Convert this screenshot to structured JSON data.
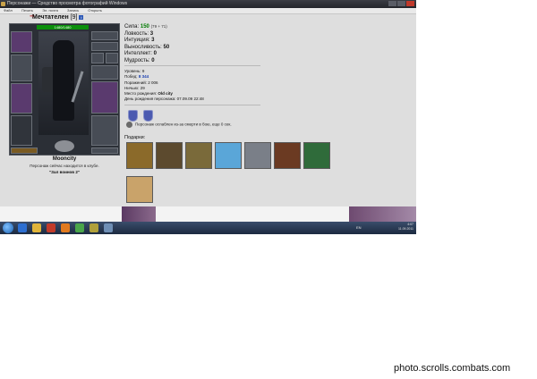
{
  "window": {
    "title": "Персонажи — Средство просмотра фотографий Windows",
    "menu": [
      "Файл",
      "Печать",
      "Эл. почта",
      "Запись",
      "Открыть"
    ]
  },
  "character": {
    "name": "Мечтателен",
    "level": "[9]",
    "info_badge": "i",
    "hp": "1480/1480",
    "owner": "Mooncity",
    "location_text": "Персонаж сейчас находится в клубе.",
    "location_room": "\"Зал воинов 2\""
  },
  "stats": [
    {
      "label": "Сила:",
      "value": "150",
      "extra": "(79 + 71)"
    },
    {
      "label": "Ловкость:",
      "value": "3"
    },
    {
      "label": "Интуиция:",
      "value": "3"
    },
    {
      "label": "Выносливость:",
      "value": "50"
    },
    {
      "label": "Интеллект:",
      "value": "0"
    },
    {
      "label": "Мудрость:",
      "value": "0"
    }
  ],
  "info": {
    "level_label": "Уровень:",
    "level_value": "9",
    "wins_label": "Побед:",
    "wins_value": "8 344",
    "losses_label": "Поражений:",
    "losses_value": "2 006",
    "draws_label": "Ничьих:",
    "draws_value": "29",
    "birthplace_label": "Место рождения:",
    "birthplace_value": "Old city",
    "birthday_label": "День рождения персонажа:",
    "birthday_value": "07.09.09 22:48"
  },
  "weakness": "Персонаж ослаблен из-за смерти в бою, еще 0 сек.",
  "gifts_label": "Подарки:",
  "gift_colors": [
    "#8b6a2a",
    "#5c4a2e",
    "#7a6a3a",
    "#5aa6d8",
    "#7a7f88",
    "#6b3a22",
    "#2f6b3a",
    "#c9a36a"
  ],
  "taskbar": {
    "lang": "EN",
    "time": "4:07",
    "date": "11.09.2011"
  },
  "footer": "photo.scrolls.combats.com"
}
